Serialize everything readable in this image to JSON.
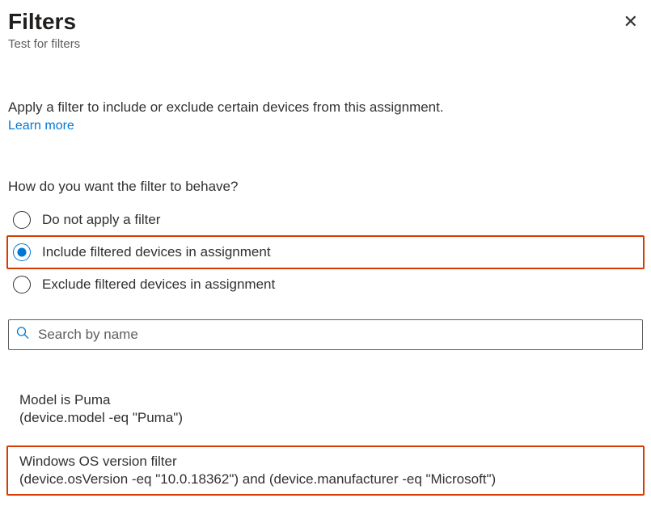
{
  "header": {
    "title": "Filters",
    "subtitle": "Test for filters",
    "close_label": "✕"
  },
  "description": "Apply a filter to include or exclude certain devices from this assignment.",
  "learn_more": "Learn more",
  "behavior": {
    "question": "How do you want the filter to behave?",
    "options": [
      {
        "label": "Do not apply a filter",
        "selected": false,
        "highlighted": false
      },
      {
        "label": "Include filtered devices in assignment",
        "selected": true,
        "highlighted": true
      },
      {
        "label": "Exclude filtered devices in assignment",
        "selected": false,
        "highlighted": false
      }
    ]
  },
  "search": {
    "placeholder": "Search by name",
    "value": ""
  },
  "filters": [
    {
      "name": "Model is Puma",
      "expression": "(device.model -eq \"Puma\")",
      "highlighted": false
    },
    {
      "name": "Windows OS version filter",
      "expression": "(device.osVersion -eq \"10.0.18362\") and (device.manufacturer -eq \"Microsoft\")",
      "highlighted": true
    }
  ]
}
